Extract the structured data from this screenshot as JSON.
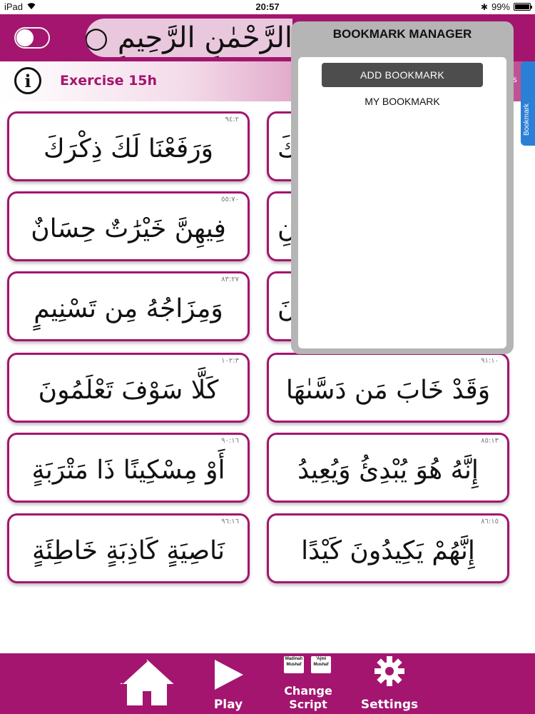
{
  "status_bar": {
    "device": "iPad",
    "wifi_icon": "wifi-icon",
    "time": "20:57",
    "bluetooth_icon": "bluetooth-icon",
    "battery": "99%"
  },
  "header": {
    "title": "الرَّحْمٰنِ الرَّحِيمِ ○",
    "toggle_state": "off"
  },
  "subheader": {
    "exercise": "Exercise 15h",
    "side_word": "es"
  },
  "cards": [
    {
      "ref": "٩٤:٢",
      "verse": "وَرَفَعْنَا لَكَ ذِكْرَكَ"
    },
    {
      "ref": "٥٥:٧٠",
      "verse": "فِيهِنَّ خَيْرَٰتٌ حِسَانٌ"
    },
    {
      "ref": "٨٣:٢٧",
      "verse": "وَمِزَاجُهُ مِن تَسْنِيمٍ"
    },
    {
      "ref": "١٠٢:٣",
      "verse": "كَلَّا سَوْفَ تَعْلَمُونَ"
    },
    {
      "ref": "٩٠:١٦",
      "verse": "أَوْ مِسْكِينًا ذَا مَتْرَبَةٍ"
    },
    {
      "ref": "٩٦:١٦",
      "verse": "نَاصِيَةٍ كَاذِبَةٍ خَاطِئَةٍ"
    },
    {
      "ref": "",
      "verse": "كَ"
    },
    {
      "ref": "",
      "verse": "نِ"
    },
    {
      "ref": "",
      "verse": "نَ"
    },
    {
      "ref": "٩١:١٠",
      "verse": "وَقَدْ خَابَ مَن دَسَّىٰهَا"
    },
    {
      "ref": "٨٥:١٣",
      "verse": "إِنَّهُ هُوَ يُبْدِئُ وَيُعِيدُ"
    },
    {
      "ref": "٨٦:١٥",
      "verse": "إِنَّهُمْ يَكِيدُونَ كَيْدًا"
    }
  ],
  "bookmark_manager": {
    "title": "BOOKMARK MANAGER",
    "add_label": "ADD BOOKMARK",
    "my_label": "MY BOOKMARK",
    "side_tab": "Bookmark"
  },
  "bottom_nav": {
    "home_icon": "home-icon",
    "play_label": "Play",
    "change_label_1": "Change",
    "change_label_2": "Script",
    "madinah_tag": "Madinah Mushaf",
    "ajmi_tag": "'Ajmi Mushaf",
    "settings_label": "Settings"
  },
  "colors": {
    "brand": "#a3156f",
    "card_border": "#a3156f",
    "panel": "#b5b5b5",
    "button": "#4d4d4d"
  }
}
